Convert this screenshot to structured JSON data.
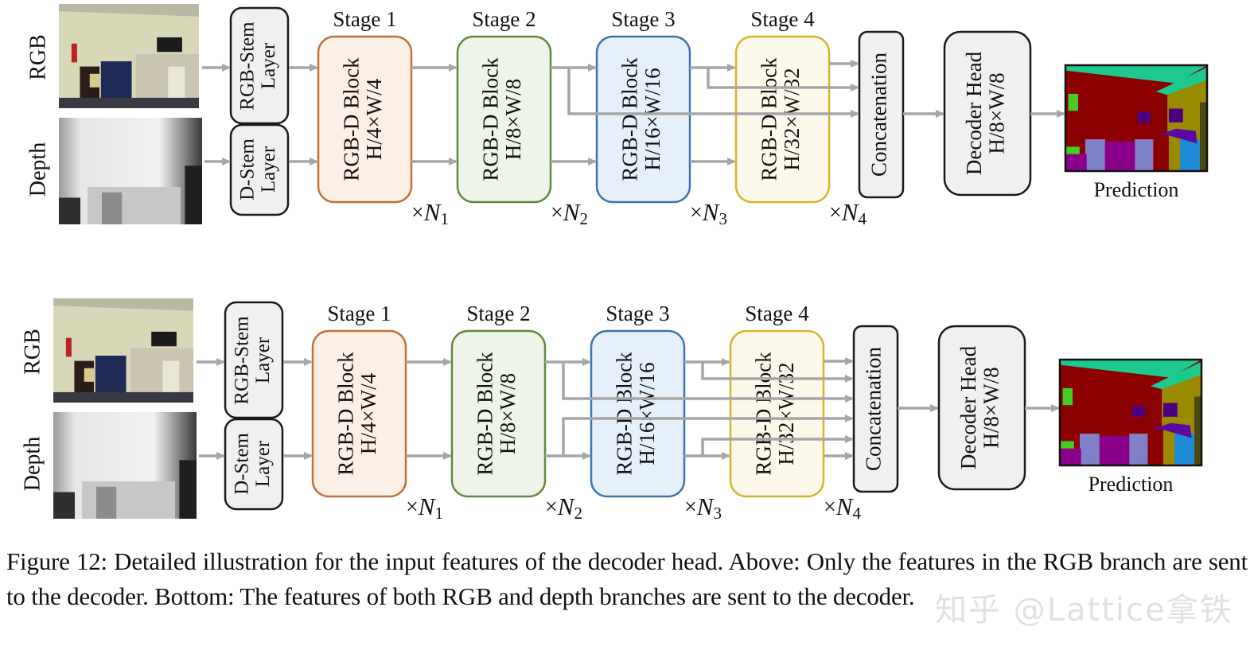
{
  "diagrams": [
    {
      "id": "above",
      "input_labels": {
        "rgb": "RGB",
        "depth": "Depth"
      },
      "stem_layers": {
        "rgb": "RGB-Stem Layer",
        "depth": "D-Stem Layer"
      },
      "stages": [
        {
          "title": "Stage 1",
          "block": "RGB-D Block",
          "resolution": "H/4×W/4",
          "repeat_symbol": "×",
          "repeat_var": "N",
          "repeat_sub": "1",
          "border": "#c0703a",
          "fill": "#fcefe6"
        },
        {
          "title": "Stage 2",
          "block": "RGB-D Block",
          "resolution": "H/8×W/8",
          "repeat_symbol": "×",
          "repeat_var": "N",
          "repeat_sub": "2",
          "border": "#5f8a3e",
          "fill": "#eef4e8"
        },
        {
          "title": "Stage 3",
          "block": "RGB-D Block",
          "resolution": "H/16×W/16",
          "repeat_symbol": "×",
          "repeat_var": "N",
          "repeat_sub": "3",
          "border": "#3d74ad",
          "fill": "#e6f0fa"
        },
        {
          "title": "Stage 4",
          "block": "RGB-D Block",
          "resolution": "H/32×W/32",
          "repeat_symbol": "×",
          "repeat_var": "N",
          "repeat_sub": "4",
          "border": "#d6b32f",
          "fill": "#fdf9ea"
        }
      ],
      "concat_label": "Concatenation",
      "decoder": {
        "title": "Decoder Head",
        "resolution": "H/8×W/8"
      },
      "output_label": "Prediction",
      "decoder_inputs": "rgb_only"
    },
    {
      "id": "bottom",
      "input_labels": {
        "rgb": "RGB",
        "depth": "Depth"
      },
      "stem_layers": {
        "rgb": "RGB-Stem Layer",
        "depth": "D-Stem Layer"
      },
      "stages": [
        {
          "title": "Stage 1",
          "block": "RGB-D Block",
          "resolution": "H/4×W/4",
          "repeat_symbol": "×",
          "repeat_var": "N",
          "repeat_sub": "1",
          "border": "#c0703a",
          "fill": "#fcefe6"
        },
        {
          "title": "Stage 2",
          "block": "RGB-D Block",
          "resolution": "H/8×W/8",
          "repeat_symbol": "×",
          "repeat_var": "N",
          "repeat_sub": "2",
          "border": "#5f8a3e",
          "fill": "#eef4e8"
        },
        {
          "title": "Stage 3",
          "block": "RGB-D Block",
          "resolution": "H/16×W/16",
          "repeat_symbol": "×",
          "repeat_var": "N",
          "repeat_sub": "3",
          "border": "#3d74ad",
          "fill": "#e6f0fa"
        },
        {
          "title": "Stage 4",
          "block": "RGB-D Block",
          "resolution": "H/32×W/32",
          "repeat_symbol": "×",
          "repeat_var": "N",
          "repeat_sub": "4",
          "border": "#d6b32f",
          "fill": "#fdf9ea"
        }
      ],
      "concat_label": "Concatenation",
      "decoder": {
        "title": "Decoder Head",
        "resolution": "H/8×W/8"
      },
      "output_label": "Prediction",
      "decoder_inputs": "rgb_and_depth"
    }
  ],
  "caption": "Figure 12: Detailed illustration for the input features of the decoder head. Above: Only the features in the RGB branch are sent to the decoder. Bottom: The features of both RGB and depth branches are sent to the decoder.",
  "watermark": "知乎 @Lattice拿铁",
  "colors": {
    "arrow": "#a6a6a6",
    "neutral_box_fill": "#f0f0f0",
    "neutral_box_border": "#1a1a1a",
    "seg_wall": "#8b0000",
    "seg_ceiling": "#1ec98f",
    "seg_cabinet": "#9a8a00",
    "seg_chair": "#8080c8",
    "seg_sofa": "#8b008b",
    "seg_counter": "#1e8ad6",
    "seg_plant": "#44cc22",
    "seg_dark": "#4b0082",
    "seg_door": "#4a4a10"
  }
}
